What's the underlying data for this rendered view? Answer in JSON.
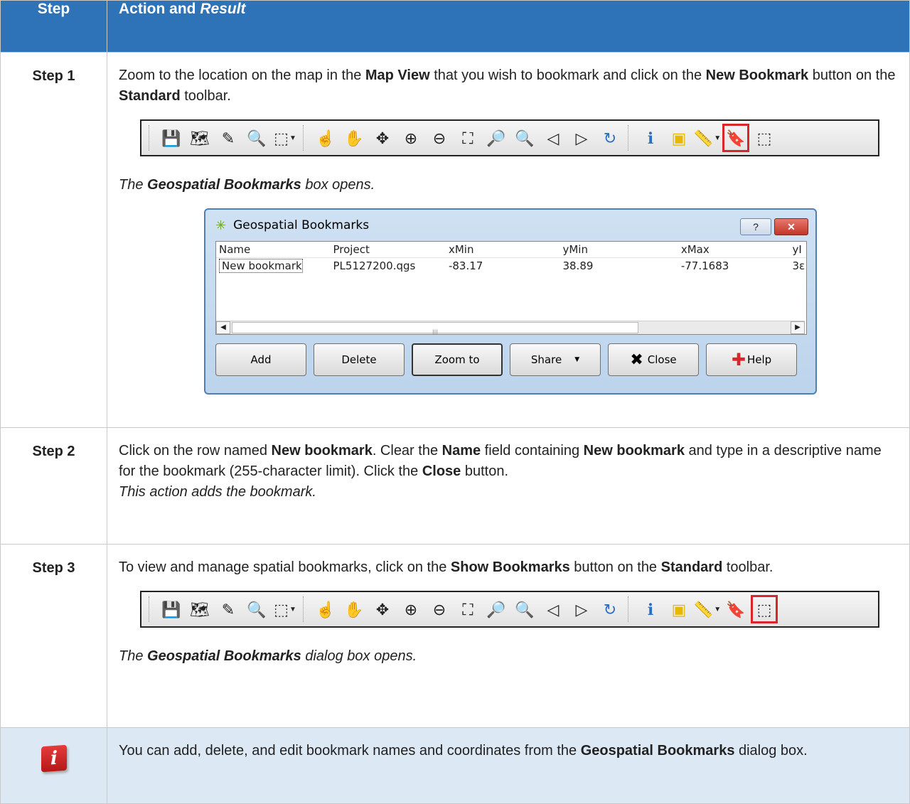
{
  "header": {
    "step": "Step",
    "action": "Action and ",
    "result": "Result"
  },
  "toolbar_icons": [
    "save-project-icon",
    "new-layer-icon",
    "digitize-icon",
    "magnifier-icon",
    "select-features-icon",
    "pan-touch-icon",
    "pan-hand-icon",
    "pan-to-selection-icon",
    "zoom-in-icon",
    "zoom-out-icon",
    "zoom-full-icon",
    "zoom-to-selection-icon",
    "zoom-to-layer-icon",
    "zoom-last-icon",
    "zoom-next-icon",
    "refresh-icon",
    "identify-icon",
    "deselect-icon",
    "measure-icon",
    "new-bookmark-icon",
    "show-bookmarks-icon"
  ],
  "step1": {
    "label": "Step 1",
    "t1": "Zoom to the location on the map in the ",
    "b1": "Map View",
    "t2": " that you wish to bookmark and click on the ",
    "b2": "New Bookmark",
    "t3": " button on the ",
    "b3": "Standard",
    "t4": " toolbar.",
    "r1": "The ",
    "rb": "Geospatial Bookmarks",
    "r2": " box opens."
  },
  "dialog": {
    "title": "Geospatial Bookmarks",
    "help_btn": "?",
    "close_btn": "✕",
    "columns": [
      "Name",
      "Project",
      "xMin",
      "yMin",
      "xMax",
      "yI"
    ],
    "row": [
      "New bookmark",
      "PL5127200.qgs",
      "-83.17",
      "38.89",
      "-77.1683",
      "3ε"
    ],
    "scroll_grip": "III",
    "buttons": {
      "add": "Add",
      "delete": "Delete",
      "zoom_to": "Zoom to",
      "share": "Share",
      "close": "Close",
      "help": "Help"
    }
  },
  "step2": {
    "label": "Step 2",
    "t1": "Click on the row named ",
    "b1": "New bookmark",
    "t2": ". Clear the ",
    "b2": "Name",
    "t3": " field containing ",
    "b3": "New bookmark",
    "t4": " and type in a descriptive name for the bookmark (255-character limit). Click the ",
    "b4": "Close",
    "t5": " button.",
    "result": "This action adds the bookmark."
  },
  "step3": {
    "label": "Step 3",
    "t1": "To view and manage spatial bookmarks, click on the ",
    "b1": "Show Bookmarks",
    "t2": " button on the ",
    "b2": "Standard",
    "t3": " toolbar.",
    "r1": "The ",
    "rb": "Geospatial Bookmarks",
    "r2": " dialog box opens."
  },
  "info": {
    "icon_letter": "i",
    "t1": "You can add, delete, and edit bookmark names and coordinates from the ",
    "b1": "Geospatial Bookmarks",
    "t2": " dialog box."
  },
  "colors": {
    "header_bg": "#2e73b7",
    "info_bg": "#dde8f5",
    "highlight": "#d9262c"
  }
}
